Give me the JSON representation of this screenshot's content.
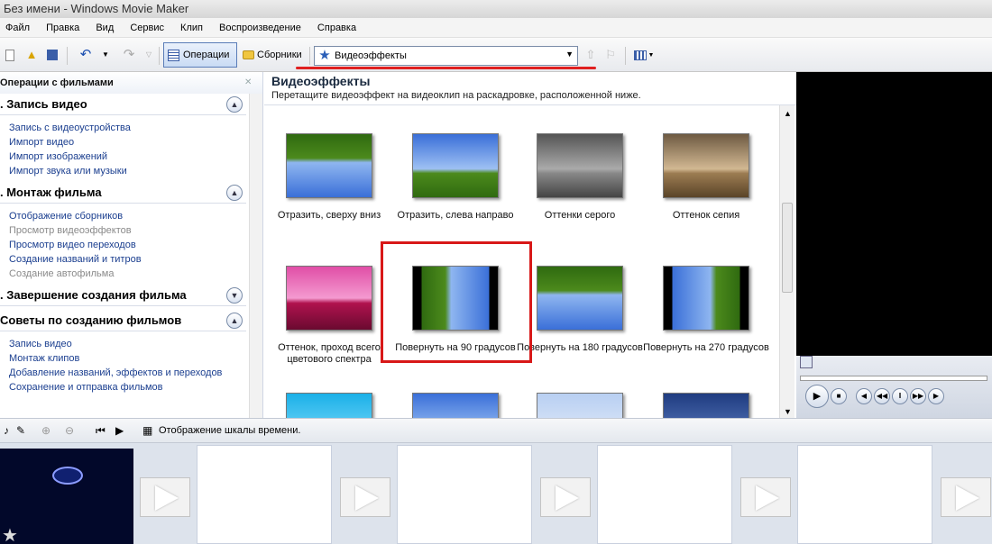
{
  "window": {
    "title": "Без имени - Windows Movie Maker"
  },
  "menu": [
    "Файл",
    "Правка",
    "Вид",
    "Сервис",
    "Клип",
    "Воспроизведение",
    "Справка"
  ],
  "toolbar": {
    "operations_label": "Операции",
    "collections_label": "Сборники",
    "collection_select": {
      "value": "Видеоэффекты"
    }
  },
  "tasks": {
    "header": "Операции с фильмами",
    "sections": [
      {
        "title": ". Запись видео",
        "expand_icon": "collapse-icon",
        "items": [
          {
            "label": "Запись с видеоустройства",
            "disabled": false
          },
          {
            "label": "Импорт видео",
            "disabled": false
          },
          {
            "label": "Импорт изображений",
            "disabled": false
          },
          {
            "label": "Импорт звука или музыки",
            "disabled": false
          }
        ]
      },
      {
        "title": ". Монтаж фильма",
        "expand_icon": "collapse-icon",
        "items": [
          {
            "label": "Отображение сборников",
            "disabled": false
          },
          {
            "label": "Просмотр видеоэффектов",
            "disabled": true
          },
          {
            "label": "Просмотр видео переходов",
            "disabled": false
          },
          {
            "label": "Создание названий и титров",
            "disabled": false
          },
          {
            "label": "Создание автофильма",
            "disabled": true
          }
        ]
      },
      {
        "title": ". Завершение создания фильма",
        "expand_icon": "expand-icon",
        "items": []
      },
      {
        "title": "Советы по созданию фильмов",
        "expand_icon": "collapse-icon",
        "items": [
          {
            "label": "Запись видео",
            "disabled": false
          },
          {
            "label": "Монтаж клипов",
            "disabled": false
          },
          {
            "label": "Добавление названий, эффектов и переходов",
            "disabled": false
          },
          {
            "label": "Сохранение и отправка фильмов",
            "disabled": false
          }
        ]
      }
    ]
  },
  "effects": {
    "heading": "Видеоэффекты",
    "subheading": "Перетащите видеоэффект на видеоклип на раскадровке, расположенной ниже.",
    "items": [
      {
        "label": "Отразить, сверху вниз",
        "style": "flip-v"
      },
      {
        "label": "Отразить, слева направо",
        "style": "flip-h"
      },
      {
        "label": "Оттенки серого",
        "style": "gray"
      },
      {
        "label": "Оттенок сепия",
        "style": "sepia"
      },
      {
        "label": "Оттенок, проход всего цветового спектра",
        "style": "magenta"
      },
      {
        "label": "Повернуть на 90 градусов",
        "style": "rot90",
        "highlighted": true
      },
      {
        "label": "Повернуть на 180 градусов",
        "style": "rot180"
      },
      {
        "label": "Повернуть на 270 градусов",
        "style": "rot270"
      },
      {
        "label": "",
        "style": "cyan"
      },
      {
        "label": "",
        "style": "normal"
      },
      {
        "label": "",
        "style": "light"
      },
      {
        "label": "",
        "style": "dark"
      }
    ]
  },
  "storyboard": {
    "timeline_label": "Отображение шкалы времени."
  },
  "colors": {
    "highlight": "#d81818",
    "link": "#1a3e8f",
    "sky": "#3a6fd8",
    "grass": "#4c8a1c"
  }
}
